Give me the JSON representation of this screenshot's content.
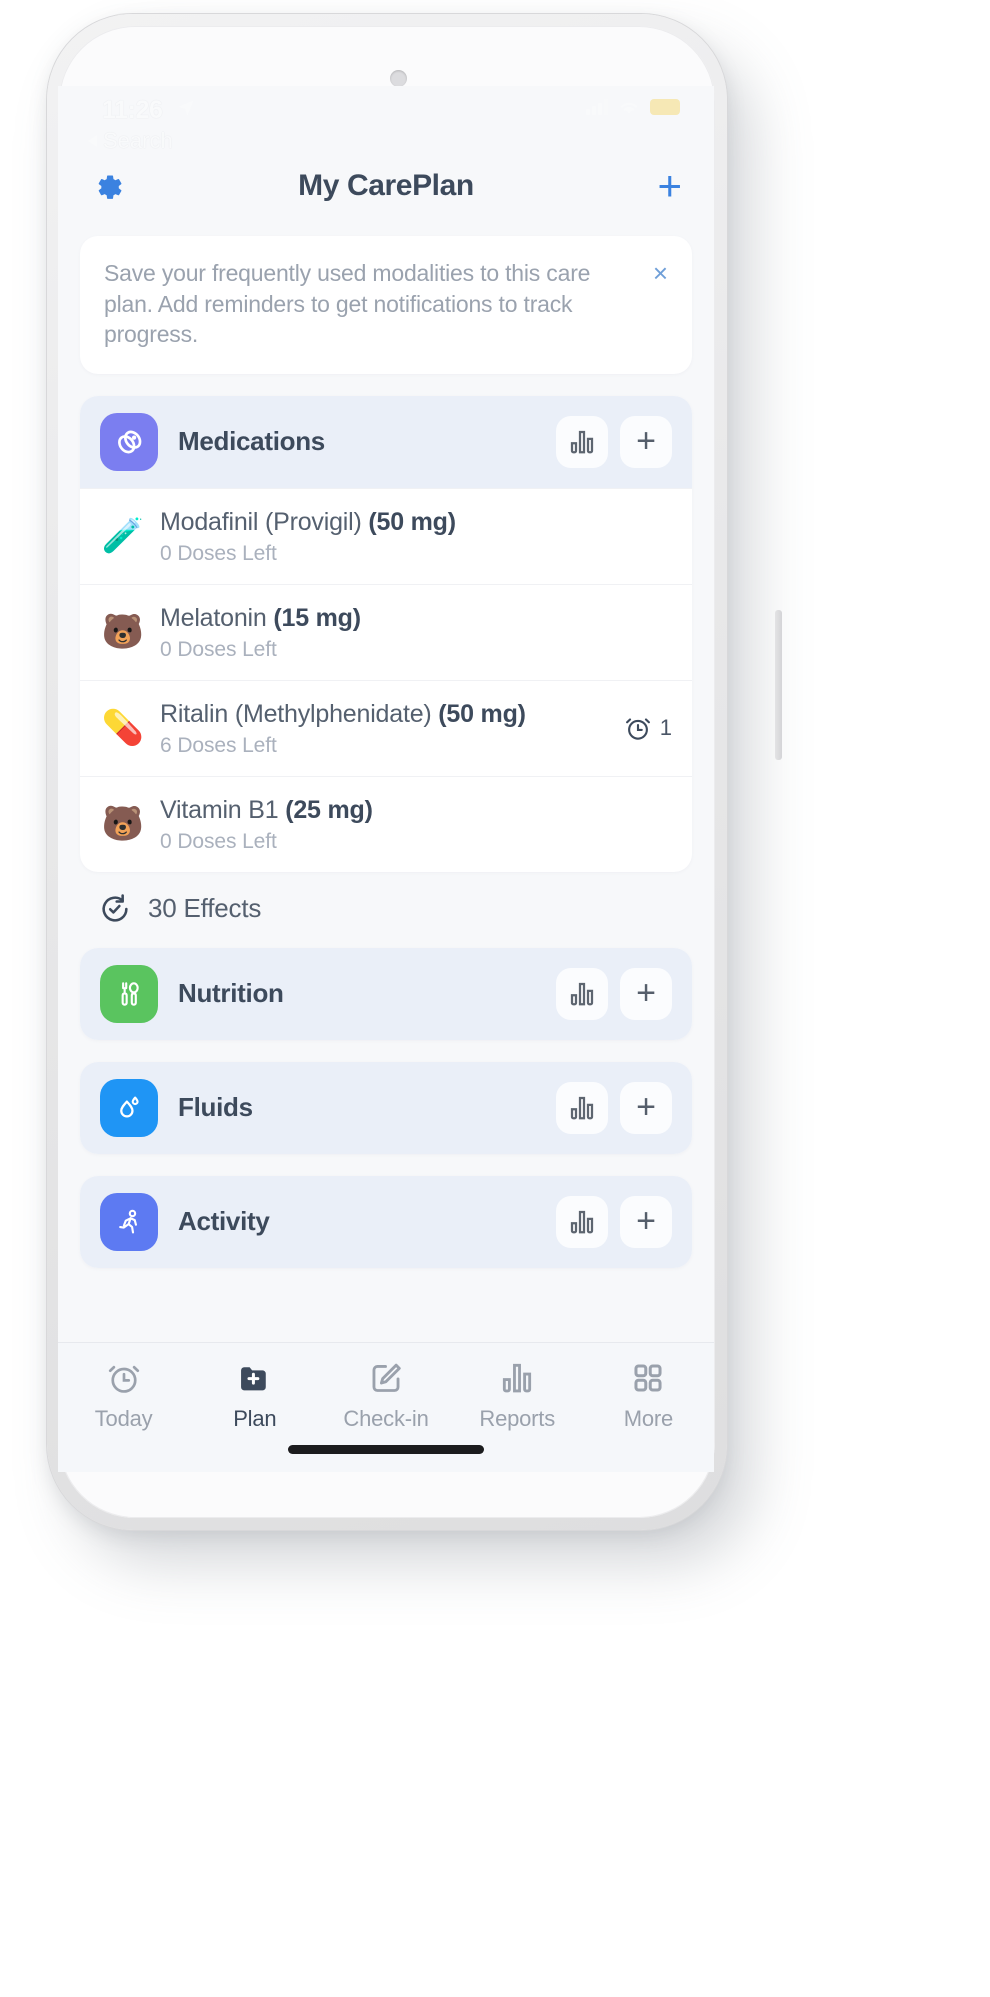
{
  "status_bar": {
    "time": "11:26",
    "location_icon": "location-arrow-icon",
    "back_label": "Search",
    "signal_icon": "cellular-signal-icon",
    "wifi_icon": "wifi-icon",
    "battery_icon": "battery-icon",
    "battery_color": "#f5c518"
  },
  "navbar": {
    "settings_icon": "gear-icon",
    "title": "My CarePlan",
    "add_label": "+",
    "accent_color": "#3b82e0"
  },
  "banner": {
    "text": "Save your frequently used modalities to this care plan. Add reminders to get notifications to track progress.",
    "close_label": "×"
  },
  "sections": [
    {
      "id": "medications",
      "title": "Medications",
      "icon": "pills-icon",
      "icon_color": "#7b7ef0",
      "chart_button_label": "chart-icon",
      "add_button_label": "+",
      "items": [
        {
          "emoji": "🧪",
          "emoji_name": "test-tube-icon",
          "name": "Modafinil (Provigil) ",
          "dose": "(50 mg)",
          "sub": "0 Doses Left",
          "reminder_count": ""
        },
        {
          "emoji": "🐻",
          "emoji_name": "gummy-bear-icon",
          "name": "Melatonin ",
          "dose": "(15 mg)",
          "sub": "0 Doses Left",
          "reminder_count": ""
        },
        {
          "emoji": "💊",
          "emoji_name": "capsule-icon",
          "name": "Ritalin (Methylphenidate) ",
          "dose": "(50 mg)",
          "sub": "6 Doses Left",
          "reminder_count": "1"
        },
        {
          "emoji": "🐻",
          "emoji_name": "gummy-bear-icon",
          "name": "Vitamin B1 ",
          "dose": "(25 mg)",
          "sub": "0 Doses Left",
          "reminder_count": ""
        }
      ]
    },
    {
      "id": "nutrition",
      "title": "Nutrition",
      "icon": "cutlery-icon",
      "icon_color": "#5ac45f",
      "chart_button_label": "chart-icon",
      "add_button_label": "+",
      "items": []
    },
    {
      "id": "fluids",
      "title": "Fluids",
      "icon": "water-drop-icon",
      "icon_color": "#1f95f5",
      "chart_button_label": "chart-icon",
      "add_button_label": "+",
      "items": []
    },
    {
      "id": "activity",
      "title": "Activity",
      "icon": "running-person-icon",
      "icon_color": "#5d7af2",
      "chart_button_label": "chart-icon",
      "add_button_label": "+",
      "items": []
    }
  ],
  "effects": {
    "icon": "history-clock-icon",
    "label": "30 Effects"
  },
  "tabbar": {
    "items": [
      {
        "label": "Today",
        "icon": "alarm-clock-icon",
        "active": false
      },
      {
        "label": "Plan",
        "icon": "folder-plus-icon",
        "active": true
      },
      {
        "label": "Check-in",
        "icon": "edit-square-icon",
        "active": false
      },
      {
        "label": "Reports",
        "icon": "bar-chart-icon",
        "active": false
      },
      {
        "label": "More",
        "icon": "grid-squares-icon",
        "active": false
      }
    ]
  }
}
